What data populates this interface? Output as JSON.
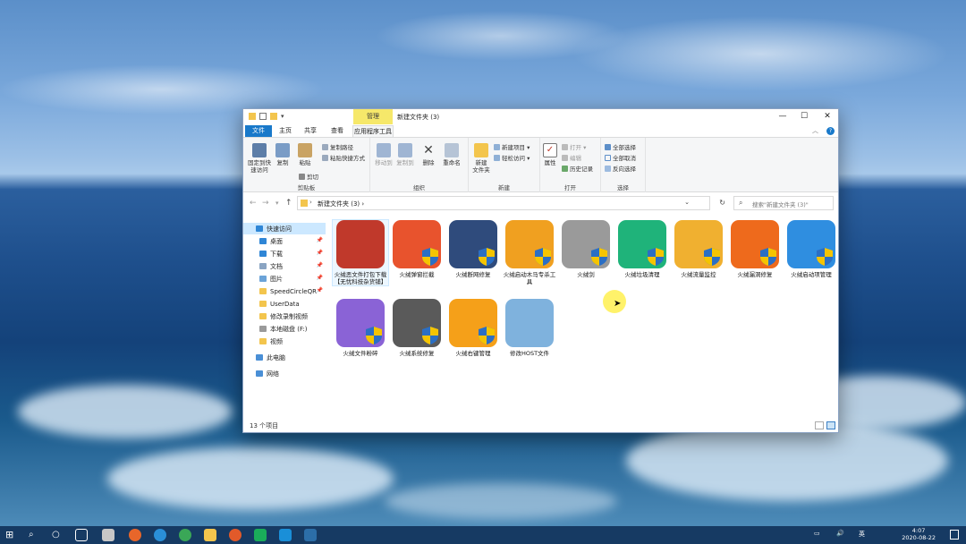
{
  "window": {
    "context_tab": "管理",
    "title": "新建文件夹 (3)",
    "controls": [
      "—",
      "☐",
      "✕"
    ]
  },
  "tabs": [
    "文件",
    "主页",
    "共享",
    "查看",
    "应用程序工具"
  ],
  "ribbon": {
    "clipboard": {
      "pin_label": "固定到快\n速访问",
      "copy_label": "复制",
      "paste_label": "粘贴",
      "cut_label": "剪切",
      "copy_path_label": "复制路径",
      "paste_shortcut_label": "粘贴快捷方式",
      "group_label": "剪贴板"
    },
    "organize": {
      "move_label": "移动到",
      "copyto_label": "复制到",
      "delete_label": "删除",
      "rename_label": "重命名",
      "group_label": "组织"
    },
    "new": {
      "folder_label": "新建\n文件夹",
      "item_label": "新建项目 ▾",
      "easy_label": "轻松访问 ▾",
      "group_label": "新建"
    },
    "open": {
      "props_label": "属性",
      "open_label": "打开 ▾",
      "edit_label": "编辑",
      "history_label": "历史记录",
      "group_label": "打开"
    },
    "select": {
      "all_label": "全部选择",
      "none_label": "全部取消",
      "invert_label": "反向选择",
      "group_label": "选择"
    }
  },
  "address": {
    "crumb": "新建文件夹 (3)  ›",
    "search_placeholder": "搜索\"新建文件夹 (3)\""
  },
  "nav": {
    "items": [
      {
        "label": "快速访问",
        "pinned": false
      },
      {
        "label": "桌面",
        "pinned": true
      },
      {
        "label": "下载",
        "pinned": true
      },
      {
        "label": "文档",
        "pinned": true
      },
      {
        "label": "图片",
        "pinned": true
      },
      {
        "label": "SpeedCircleQR",
        "pinned": true
      },
      {
        "label": "UserData",
        "pinned": false
      },
      {
        "label": "修改录制视频",
        "pinned": false
      },
      {
        "label": "本地磁盘 (F:)",
        "pinned": false
      },
      {
        "label": "视频",
        "pinned": false
      },
      {
        "label": "此电脑",
        "pinned": false
      },
      {
        "label": "网络",
        "pinned": false
      }
    ]
  },
  "files": [
    {
      "label": "火绒恶文件打包下载【无忧科技杂货铺】",
      "color": "#c0392b"
    },
    {
      "label": "火绒弹窗拦截",
      "color": "#e8532d"
    },
    {
      "label": "火绒断网修复",
      "color": "#2f4b7c"
    },
    {
      "label": "火绒启动木马专杀工具",
      "color": "#f0a020"
    },
    {
      "label": "火绒剑",
      "color": "#9a9a9a"
    },
    {
      "label": "火绒垃圾清理",
      "color": "#1fb37a"
    },
    {
      "label": "火绒流量监控",
      "color": "#f0b030"
    },
    {
      "label": "火绒漏洞修复",
      "color": "#ee6a1c"
    },
    {
      "label": "火绒启动项管理",
      "color": "#2f8ee0"
    },
    {
      "label": "火绒文件粉碎",
      "color": "#8a63d6"
    },
    {
      "label": "火绒系统修复",
      "color": "#5a5a5a"
    },
    {
      "label": "火绒右键管理",
      "color": "#f5a019"
    },
    {
      "label": "修改HOST文件",
      "color": "#7fb2dd"
    }
  ],
  "status": {
    "count": "13 个项目"
  },
  "taskbar": {
    "tray_lang": "英",
    "time": "4:07",
    "date": "2020-08-22"
  }
}
